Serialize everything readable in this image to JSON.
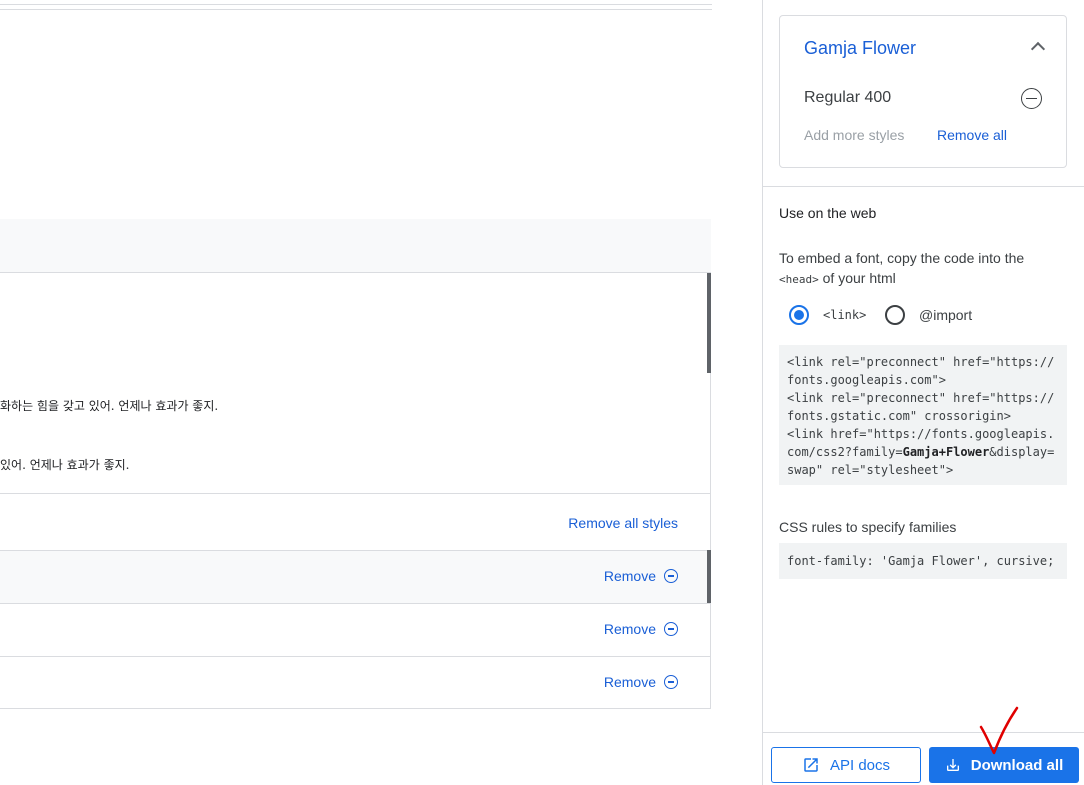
{
  "main": {
    "preview_lines": [
      "화하는 힘을 갖고 있어. 언제나 효과가 좋지.",
      "있어. 언제나 효과가 좋지."
    ],
    "remove_all_styles_label": "Remove all styles",
    "style_rows": [
      {
        "remove_label": "Remove"
      },
      {
        "remove_label": "Remove"
      },
      {
        "remove_label": "Remove"
      }
    ]
  },
  "sidebar": {
    "family_name": "Gamja Flower",
    "selected_style": "Regular 400",
    "add_more_styles": "Add more styles",
    "remove_all": "Remove all",
    "use_on_web_title": "Use on the web",
    "embed_desc_prefix": "To embed a font, copy the code into the",
    "embed_desc_tag": "<head>",
    "embed_desc_suffix": "of your html",
    "radio_link_label": "<link>",
    "radio_import_label": "@import",
    "selected_method": "<link>",
    "code_line1": "<link rel=\"preconnect\" href=\"https://",
    "code_line2": "fonts.googleapis.com\">",
    "code_line3": "<link rel=\"preconnect\" href=\"https://",
    "code_line4": "fonts.gstatic.com\" crossorigin>",
    "code_line5": "<link href=\"https://fonts.googleapis.",
    "code_line6_pre": "com/css2?family=",
    "code_line6_bold": "Gamja+Flower",
    "code_line6_post": "&display=",
    "code_line7": "swap\" rel=\"stylesheet\">",
    "css_rules_title": "CSS rules to specify families",
    "css_rule": "font-family: 'Gamja Flower', cursive;",
    "api_docs_label": "API docs",
    "download_all_label": "Download all"
  },
  "colors": {
    "accent": "#1a73e8",
    "link": "#1a5fd6",
    "annotation": "#e00000"
  }
}
